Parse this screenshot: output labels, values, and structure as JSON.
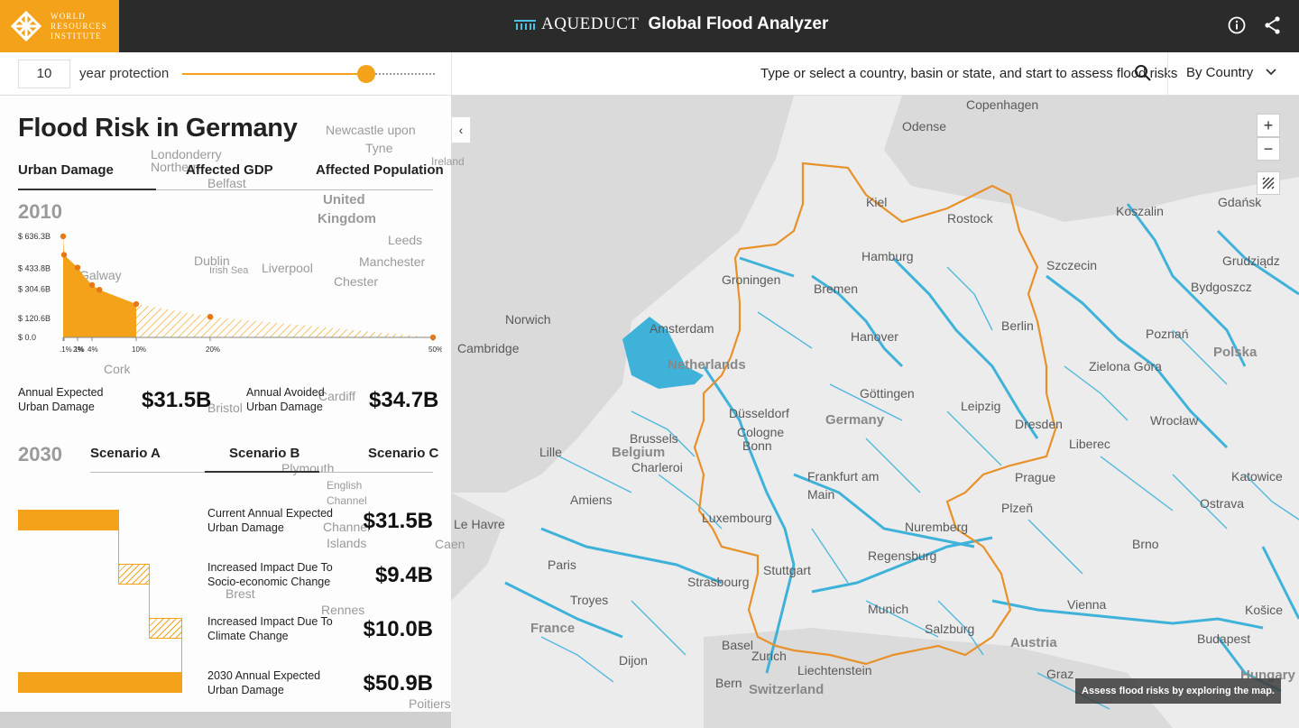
{
  "header": {
    "org_line1": "WORLD",
    "org_line2": "RESOURCES",
    "org_line3": "INSTITUTE",
    "product": "AQUEDUCT",
    "app_title": "Global Flood Analyzer"
  },
  "controls": {
    "protection_years": "10",
    "protection_label": "year protection",
    "search_prompt": "Type or select a country, basin or state, and start to assess flood risks",
    "group_select": "By Country"
  },
  "panel": {
    "title": "Flood Risk in Germany",
    "tabs": [
      "Urban Damage",
      "Affected GDP",
      "Affected Population"
    ],
    "year_2010": "2010",
    "annual_expected_label_1": "Annual Expected",
    "annual_expected_label_2": "Urban Damage",
    "annual_expected_value": "$31.5B",
    "annual_avoided_label_1": "Annual Avoided",
    "annual_avoided_label_2": "Urban Damage",
    "annual_avoided_value": "$34.7B",
    "year_2030": "2030",
    "scenarios": [
      "Scenario A",
      "Scenario B",
      "Scenario C"
    ],
    "waterfall": [
      {
        "label1": "Current Annual Expected",
        "label2": "Urban Damage",
        "value": "$31.5B"
      },
      {
        "label1": "Increased Impact Due To",
        "label2": "Socio-economic Change",
        "value": "$9.4B"
      },
      {
        "label1": "Increased Impact Due To",
        "label2": "Climate Change",
        "value": "$10.0B"
      },
      {
        "label1": "2030 Annual Expected",
        "label2": "Urban Damage",
        "value": "$50.9B"
      }
    ]
  },
  "chart_data": {
    "type": "area",
    "x": [
      0.1,
      1,
      2,
      3,
      4,
      5,
      10,
      20,
      50
    ],
    "x_tick_labels": [
      ".1%",
      "1%",
      "2%",
      "4%",
      "10%",
      "20%",
      "50%"
    ],
    "y_tick_labels": [
      "$ 636.3B",
      "$ 433.8B",
      "$ 304.6B",
      "$ 120.6B",
      "$ 0.0"
    ],
    "ylim": [
      0,
      636.3
    ],
    "y": [
      636.3,
      520,
      440,
      380,
      330,
      300,
      210,
      130,
      0
    ],
    "protected_up_to_x": 10,
    "colors": {
      "series": "#f3a21a",
      "points": "#e87716"
    }
  },
  "map": {
    "toast": "Assess flood risks by exploring the map.",
    "zoom_in": "+",
    "zoom_out": "−",
    "labels": [
      "Copenhagen",
      "Odense",
      "Kiel",
      "Rostock",
      "Gdańsk",
      "Koszalin",
      "Hamburg",
      "Szczecin",
      "Grudziądz",
      "Bydgoszcz",
      "Groningen",
      "Bremen",
      "Norwich",
      "Amsterdam",
      "Berlin",
      "Poznań",
      "Polska",
      "Cambridge",
      "Hanover",
      "Netherlands",
      "Zielona Góra",
      "Göttingen",
      "Leipzig",
      "Dresden",
      "Wrocław",
      "Germany",
      "Düsseldorf",
      "Cologne",
      "Bonn",
      "Lille",
      "Brussels",
      "Belgium",
      "Charleroi",
      "Liberec",
      "Prague",
      "Katowice",
      "Frankfurt am",
      "Main",
      "Ostrava",
      "Amiens",
      "Luxembourg",
      "Le Havre",
      "Nuremberg",
      "Plzeň",
      "Paris",
      "Regensburg",
      "Brno",
      "Stuttgart",
      "Strasbourg",
      "Troyes",
      "Munich",
      "Vienna",
      "France",
      "Salzburg",
      "Košice",
      "Basel",
      "Zurich",
      "Austria",
      "Budapest",
      "Dijon",
      "Liechtenstein",
      "Bern",
      "Switzerland",
      "Graz",
      "Hungary",
      "Newcastle upon",
      "Tyne",
      "United",
      "Kingdom",
      "Leeds",
      "Dublin",
      "Liverpool",
      "Manchester",
      "Irish Sea",
      "Chester",
      "Galway",
      "Cardiff",
      "Bristol",
      "Cork",
      "Plymouth",
      "English",
      "Channel",
      "Channel",
      "Islands",
      "Brest",
      "Rennes",
      "Poitiers",
      "Caen",
      "Londonderry",
      "Northern",
      "Ireland",
      "Belfast"
    ]
  }
}
